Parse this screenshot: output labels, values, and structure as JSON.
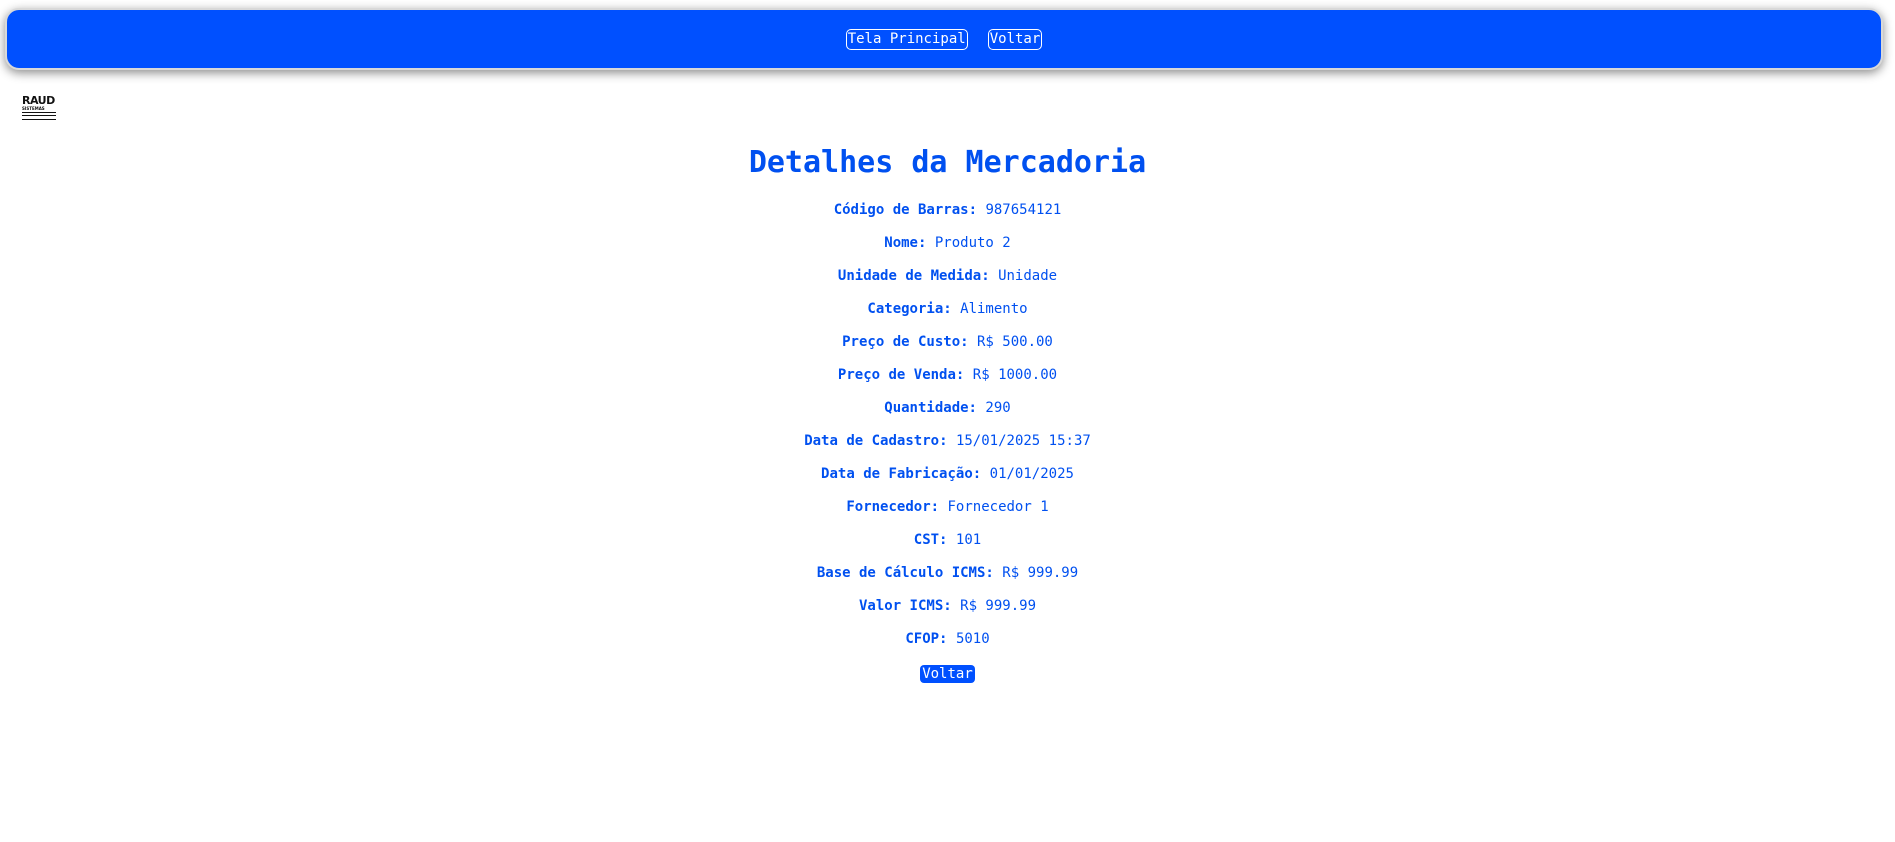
{
  "nav": {
    "home_label": "Tela Principal",
    "back_label": "Voltar"
  },
  "logo": {
    "main": "RAUD",
    "sub": "SISTEMAS"
  },
  "page": {
    "title": "Detalhes da Mercadoria"
  },
  "details": [
    {
      "label": "Código de Barras:",
      "value": "987654121"
    },
    {
      "label": "Nome:",
      "value": "Produto 2"
    },
    {
      "label": "Unidade de Medida:",
      "value": "Unidade"
    },
    {
      "label": "Categoria:",
      "value": "Alimento"
    },
    {
      "label": "Preço de Custo:",
      "value": "R$ 500.00"
    },
    {
      "label": "Preço de Venda:",
      "value": "R$ 1000.00"
    },
    {
      "label": "Quantidade:",
      "value": "290"
    },
    {
      "label": "Data de Cadastro:",
      "value": "15/01/2025 15:37"
    },
    {
      "label": "Data de Fabricação:",
      "value": "01/01/2025"
    },
    {
      "label": "Fornecedor:",
      "value": "Fornecedor 1"
    },
    {
      "label": "CST:",
      "value": "101"
    },
    {
      "label": "Base de Cálculo ICMS:",
      "value": "R$ 999.99"
    },
    {
      "label": "Valor ICMS:",
      "value": "R$ 999.99"
    },
    {
      "label": "CFOP:",
      "value": "5010"
    }
  ],
  "footer": {
    "back_label": "Voltar"
  },
  "colors": {
    "primary": "#0050ff",
    "text": "#0050f0",
    "background": "#ffffff"
  }
}
